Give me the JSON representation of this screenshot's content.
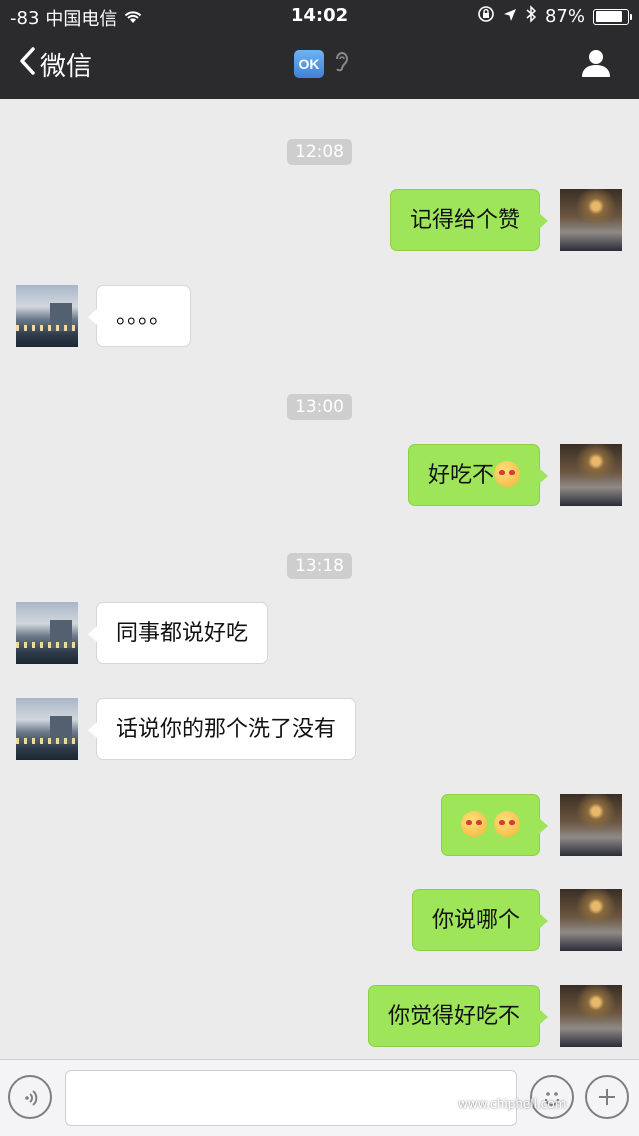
{
  "status_bar": {
    "signal": "-83",
    "carrier": "中国电信",
    "time": "14:02",
    "battery": "87%",
    "battery_level": 0.87
  },
  "nav": {
    "back_label": "微信",
    "ok_badge": "OK"
  },
  "messages": [
    {
      "type": "time",
      "text": "12:08"
    },
    {
      "type": "msg",
      "side": "right",
      "text": "记得给个赞"
    },
    {
      "type": "msg",
      "side": "left",
      "text": "。。。。"
    },
    {
      "type": "time",
      "text": "13:00"
    },
    {
      "type": "msg",
      "side": "right",
      "text": "好吃不"
    },
    {
      "type": "time",
      "text": "13:18"
    },
    {
      "type": "msg",
      "side": "left",
      "text": "同事都说好吃"
    },
    {
      "type": "msg",
      "side": "left",
      "text": "话说你的那个洗了没有"
    },
    {
      "type": "msg",
      "side": "right",
      "text": ""
    },
    {
      "type": "msg",
      "side": "right",
      "text": "你说哪个"
    },
    {
      "type": "msg",
      "side": "right",
      "text": "你觉得好吃不"
    }
  ],
  "input": {
    "value": ""
  },
  "watermark": "www.chiphell.com",
  "colors": {
    "header": "#2b2b2d",
    "chat_bg": "#ebebeb",
    "sent_bubble": "#9fe55a",
    "received_bubble": "#ffffff",
    "timestamp_bg": "#cecece"
  }
}
